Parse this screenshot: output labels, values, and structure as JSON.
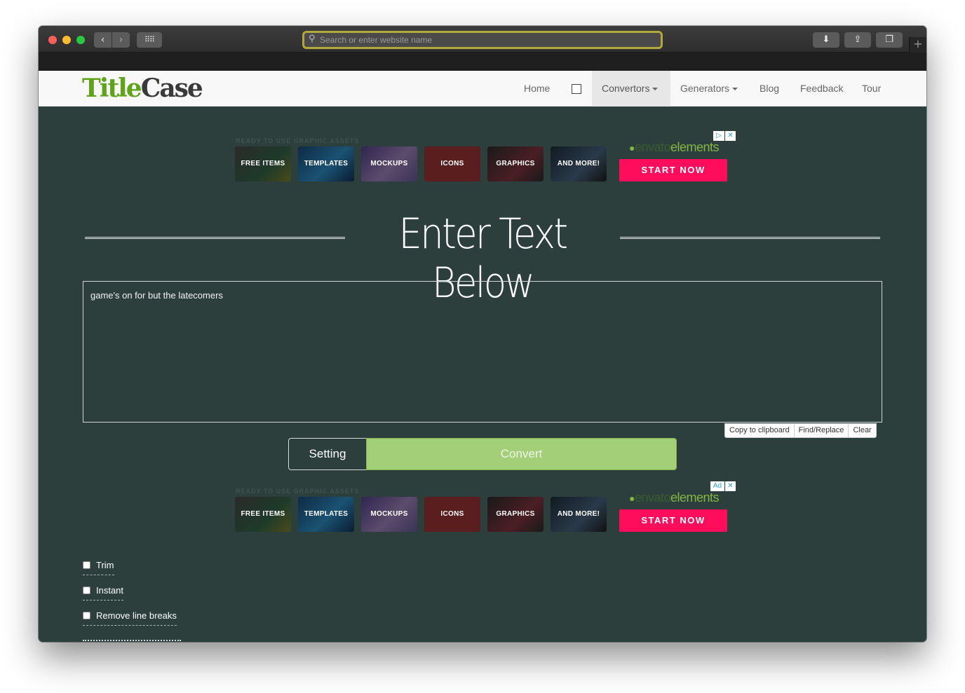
{
  "browser": {
    "url_placeholder": "Search or enter website name",
    "url_value": ""
  },
  "site": {
    "logo": {
      "part1": "Title",
      "part2": "Case"
    },
    "nav": {
      "home": "Home",
      "convertors": "Convertors",
      "generators": "Generators",
      "blog": "Blog",
      "feedback": "Feedback",
      "tour": "Tour"
    }
  },
  "ad_top": {
    "heading": "READY TO USE GRAPHIC ASSETS",
    "tiles": [
      "FREE ITEMS",
      "TEMPLATES",
      "MOCKUPS",
      "ICONS",
      "GRAPHICS",
      "AND MORE!"
    ],
    "brand_part1": "envato",
    "brand_part2": "elements",
    "cta": "START NOW"
  },
  "ad_bottom": {
    "heading": "READY TO USE GRAPHIC ASSETS",
    "tiles": [
      "FREE ITEMS",
      "TEMPLATES",
      "MOCKUPS",
      "ICONS",
      "GRAPHICS",
      "AND MORE!"
    ],
    "brand_part1": "envato",
    "brand_part2": "elements",
    "cta": "START NOW",
    "ad_label": "Ad"
  },
  "main": {
    "heading": "Enter Text Below",
    "input_text": "game's on for but the latecomers",
    "actions": {
      "copy": "Copy to clipboard",
      "find_replace": "Find/Replace",
      "clear": "Clear"
    },
    "setting_label": "Setting",
    "convert_label": "Convert"
  },
  "options": {
    "trim": "Trim",
    "instant": "Instant",
    "remove_line_breaks": "Remove line breaks"
  },
  "colors": {
    "page_bg": "#2d3f3d",
    "convert_green": "#a3cf78",
    "logo_green": "#5fa31a",
    "cta_pink": "#ff0d5d",
    "url_focus": "#b2a83b"
  }
}
